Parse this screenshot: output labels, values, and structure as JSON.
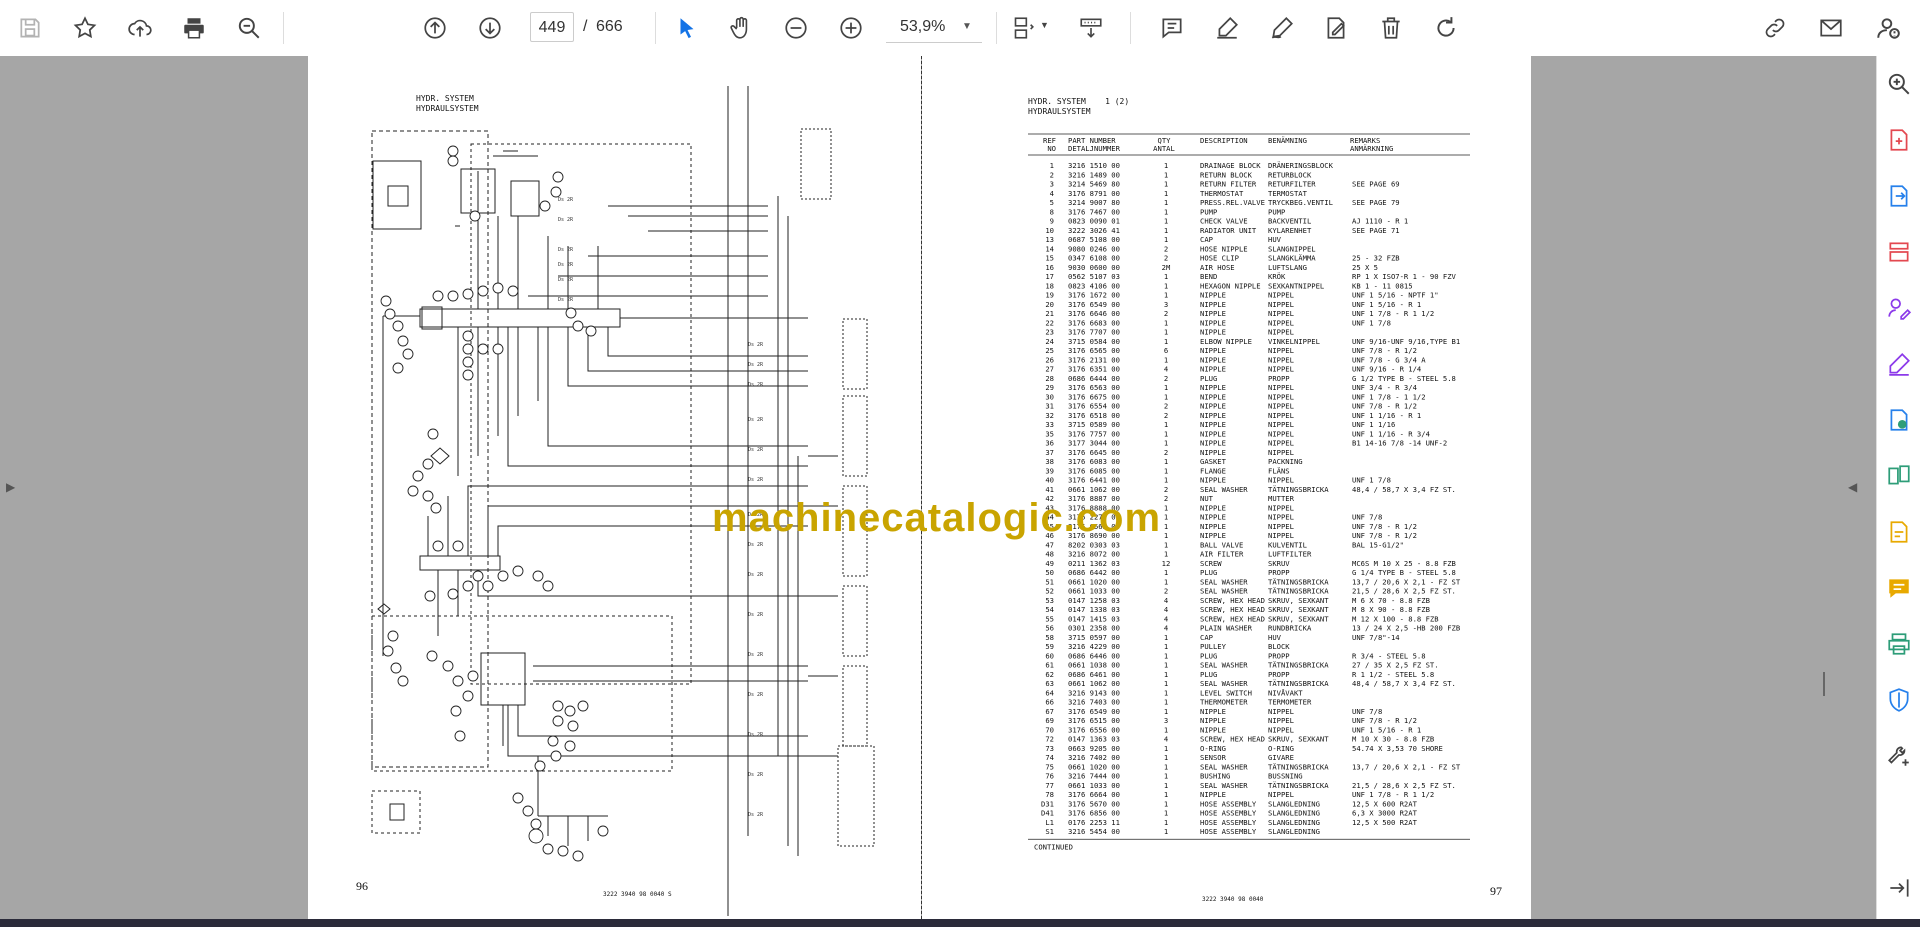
{
  "toolbar": {
    "current_page": "449",
    "page_separator": "/",
    "total_pages": "666",
    "zoom": "53,9%",
    "icons": [
      "save-icon",
      "bookmark-star-icon",
      "upload-icon",
      "print-icon",
      "zoom-search-icon",
      "page-up-icon",
      "page-down-icon",
      "select-cursor-icon",
      "hand-icon",
      "zoom-out-icon",
      "zoom-in-icon",
      "fit-page-icon",
      "scroll-mode-icon",
      "comment-icon",
      "highlight-icon",
      "draw-icon",
      "fill-sign-icon",
      "delete-icon",
      "redo-icon",
      "share-link-icon",
      "email-icon",
      "account-icon"
    ]
  },
  "colors": {
    "accent": "#1473e6",
    "viewer_bg": "#a6a6a6",
    "watermark": "#c9a400",
    "tool_red": "#e34850",
    "tool_blue": "#2680eb",
    "tool_purple": "#8c3aea",
    "tool_green": "#2d9d78",
    "tool_yellow": "#e8a900"
  },
  "left_page": {
    "title_1": "HYDR. SYSTEM",
    "title_2": "HYDRAULSYSTEM",
    "page_number": "96",
    "footer_code": "3222 3940 98   0040  S"
  },
  "right_page": {
    "title_1": "HYDR. SYSTEM    1 (2)",
    "title_2": "HYDRAULSYSTEM",
    "page_number": "97",
    "footer_code": "3222 3940 98   0040",
    "continued": "CONTINUED",
    "headers": [
      "REF NO",
      "PART NUMBER DETALJNUMMER",
      "QTY ANTAL",
      "DESCRIPTION",
      "BENÄMNING",
      "REMARKS ANMÄRKNING"
    ],
    "rows": [
      [
        "1",
        "3216 1510 00",
        "1",
        "DRAINAGE BLOCK",
        "DRÄNERINGSBLOCK",
        ""
      ],
      [
        "2",
        "3216 1489 00",
        "1",
        "RETURN BLOCK",
        "RETURBLOCK",
        ""
      ],
      [
        "3",
        "3214 5469 80",
        "1",
        "RETURN FILTER",
        "RETURFILTER",
        "SEE PAGE 69"
      ],
      [
        "4",
        "3176 8791 00",
        "1",
        "THERMOSTAT",
        "TERMOSTAT",
        ""
      ],
      [
        "5",
        "3214 9007 80",
        "1",
        "PRESS.REL.VALVE",
        "TRYCKBEG.VENTIL",
        "SEE PAGE 79"
      ],
      [
        "8",
        "3176 7467 00",
        "1",
        "PUMP",
        "PUMP",
        ""
      ],
      [
        "9",
        "0823 0090 01",
        "1",
        "CHECK VALVE",
        "BACKVENTIL",
        "AJ 1110 - R 1"
      ],
      [
        "10",
        "3222 3026 41",
        "1",
        "RADIATOR UNIT",
        "KYLARENHET",
        "SEE PAGE 71"
      ],
      [
        "13",
        "0687 5108 00",
        "1",
        "CAP",
        "HUV",
        ""
      ],
      [
        "14",
        "9080 0246 00",
        "2",
        "HOSE NIPPLE",
        "SLANGNIPPEL",
        ""
      ],
      [
        "15",
        "0347 6108 00",
        "2",
        "HOSE CLIP",
        "SLANGKLÄMMA",
        "25 - 32 FZB"
      ],
      [
        "16",
        "9030 0600 00",
        "2M",
        "AIR HOSE",
        "LUFTSLANG",
        "25   X 5"
      ],
      [
        "17",
        "0562 5107 03",
        "1",
        "BEND",
        "KRÖK",
        "RP 1 X ISO7-R 1 - 90 FZV"
      ],
      [
        "18",
        "0823 4106 00",
        "1",
        "HEXAGON NIPPLE",
        "SEXKANTNIPPEL",
        "KB 1 - 11 0815"
      ],
      [
        "19",
        "3176 1672 00",
        "1",
        "NIPPLE",
        "NIPPEL",
        "UNF 1 5/16 - NPTF 1\""
      ],
      [
        "20",
        "3176 6549 00",
        "3",
        "NIPPLE",
        "NIPPEL",
        "UNF 1 5/16 - R 1"
      ],
      [
        "21",
        "3176 6646 00",
        "2",
        "NIPPLE",
        "NIPPEL",
        "UNF 1 7/8 - R 1 1/2"
      ],
      [
        "22",
        "3176 6683 00",
        "1",
        "NIPPLE",
        "NIPPEL",
        "UNF 1 7/8"
      ],
      [
        "23",
        "3176 7707 00",
        "1",
        "NIPPLE",
        "NIPPEL",
        ""
      ],
      [
        "24",
        "3715 0584 00",
        "1",
        "ELBOW NIPPLE",
        "VINKELNIPPEL",
        "UNF 9/16-UNF 9/16,TYPE B1"
      ],
      [
        "25",
        "3176 6565 00",
        "6",
        "NIPPLE",
        "NIPPEL",
        "UNF 7/8 - R 1/2"
      ],
      [
        "26",
        "3176 2131 00",
        "1",
        "NIPPLE",
        "NIPPEL",
        "UNF 7/8 - G 3/4 A"
      ],
      [
        "27",
        "3176 6351 00",
        "4",
        "NIPPLE",
        "NIPPEL",
        "UNF 9/16 - R 1/4"
      ],
      [
        "28",
        "0686 6444 00",
        "2",
        "PLUG",
        "PROPP",
        "G 1/2 TYPE B - STEEL 5.8"
      ],
      [
        "29",
        "3176 6563 00",
        "1",
        "NIPPLE",
        "NIPPEL",
        "UNF 3/4 - R 3/4"
      ],
      [
        "30",
        "3176 6675 00",
        "1",
        "NIPPLE",
        "NIPPEL",
        "UNF 1 7/8 - 1 1/2"
      ],
      [
        "31",
        "3176 6554 00",
        "2",
        "NIPPLE",
        "NIPPEL",
        "UNF 7/8 - R 1/2"
      ],
      [
        "32",
        "3176 6518 00",
        "2",
        "NIPPLE",
        "NIPPEL",
        "UNF 1 1/16 - R 1"
      ],
      [
        "33",
        "3715 0589 00",
        "1",
        "NIPPLE",
        "NIPPEL",
        "UNF 1 1/16"
      ],
      [
        "35",
        "3176 7757 00",
        "1",
        "NIPPLE",
        "NIPPEL",
        "UNF 1 1/16 - R 3/4"
      ],
      [
        "36",
        "3177 3044 00",
        "1",
        "NIPPLE",
        "NIPPEL",
        "B1  14-16   7/8 -14 UNF-2"
      ],
      [
        "37",
        "3176 6645 00",
        "2",
        "NIPPLE",
        "NIPPEL",
        ""
      ],
      [
        "38",
        "3176 6083 00",
        "1",
        "GASKET",
        "PACKNING",
        ""
      ],
      [
        "39",
        "3176 6085 00",
        "1",
        "FLANGE",
        "FLÄNS",
        ""
      ],
      [
        "40",
        "3176 6441 00",
        "1",
        "NIPPLE",
        "NIPPEL",
        "UNF 1 7/8"
      ],
      [
        "41",
        "0661 1062 00",
        "2",
        "SEAL WASHER",
        "TÄTNINGSBRICKA",
        "48,4 / 58,7 X 3,4 FZ ST."
      ],
      [
        "42",
        "3176 8887 00",
        "2",
        "NUT",
        "MUTTER",
        ""
      ],
      [
        "43",
        "3176 8888 00",
        "1",
        "NIPPLE",
        "NIPPEL",
        ""
      ],
      [
        "44",
        "3176 2279 00",
        "1",
        "NIPPLE",
        "NIPPEL",
        "UNF 7/8"
      ],
      [
        "45",
        "3176 6565 00",
        "1",
        "NIPPLE",
        "NIPPEL",
        "UNF 7/8 - R 1/2"
      ],
      [
        "46",
        "3176 8690 00",
        "1",
        "NIPPLE",
        "NIPPEL",
        "UNF 7/8 - R 1/2"
      ],
      [
        "47",
        "8202 0303 03",
        "1",
        "BALL VALVE",
        "KULVENTIL",
        "BAL 15-G1/2\""
      ],
      [
        "48",
        "3216 8072 00",
        "1",
        "AIR FILTER",
        "LUFTFILTER",
        ""
      ],
      [
        "49",
        "0211 1362 03",
        "12",
        "SCREW",
        "SKRUV",
        "MC6S M 10 X 25 - 8.8 FZB"
      ],
      [
        "50",
        "0686 6442 00",
        "1",
        "PLUG",
        "PROPP",
        "G 1/4 TYPE B - STEEL 5.8"
      ],
      [
        "51",
        "0661 1020 00",
        "1",
        "SEAL WASHER",
        "TÄTNINGSBRICKA",
        "13,7 / 20,6 X 2,1 - FZ ST"
      ],
      [
        "52",
        "0661 1033 00",
        "2",
        "SEAL WASHER",
        "TÄTNINGSBRICKA",
        "21,5 / 28,6 X 2,5 FZ ST."
      ],
      [
        "53",
        "0147 1258 03",
        "4",
        "SCREW, HEX HEAD",
        "SKRUV, SEXKANT",
        "M 6 X 70 - 8.8 FZB"
      ],
      [
        "54",
        "0147 1338 03",
        "4",
        "SCREW, HEX HEAD",
        "SKRUV, SEXKANT",
        "M 8 X 90 - 8.8 FZB"
      ],
      [
        "55",
        "0147 1415 03",
        "4",
        "SCREW, HEX HEAD",
        "SKRUV, SEXKANT",
        "M 12 X 100 - 8.8 FZB"
      ],
      [
        "56",
        "0301 2358 00",
        "4",
        "PLAIN WASHER",
        "RUNDBRICKA",
        "13 / 24 X 2,5 -HB 200 FZB"
      ],
      [
        "58",
        "3715 0597 00",
        "1",
        "CAP",
        "HUV",
        "UNF 7/8\"-14"
      ],
      [
        "59",
        "3216 4229 00",
        "1",
        "PULLEY",
        "BLOCK",
        ""
      ],
      [
        "60",
        "0686 6446 00",
        "1",
        "PLUG",
        "PROPP",
        "R 3/4 - STEEL 5.8"
      ],
      [
        "61",
        "0661 1038 00",
        "1",
        "SEAL WASHER",
        "TÄTNINGSBRICKA",
        "27 / 35 X 2,5 FZ ST."
      ],
      [
        "62",
        "0686 6461 00",
        "1",
        "PLUG",
        "PROPP",
        "R 1 1/2 - STEEL 5.8"
      ],
      [
        "63",
        "0661 1062 00",
        "1",
        "SEAL WASHER",
        "TÄTNINGSBRICKA",
        "48,4 / 58,7 X 3,4 FZ ST."
      ],
      [
        "64",
        "3216 9143 00",
        "1",
        "LEVEL SWITCH",
        "NIVÅVAKT",
        ""
      ],
      [
        "66",
        "3216 7403 00",
        "1",
        "THERMOMETER",
        "TERMOMETER",
        ""
      ],
      [
        "67",
        "3176 6549 00",
        "1",
        "NIPPLE",
        "NIPPEL",
        "UNF 7/8"
      ],
      [
        "69",
        "3176 6515 00",
        "3",
        "NIPPLE",
        "NIPPEL",
        "UNF 7/8 - R 1/2"
      ],
      [
        "70",
        "3176 6556 00",
        "1",
        "NIPPLE",
        "NIPPEL",
        "UNF 1 5/16 - R 1"
      ],
      [
        "72",
        "0147 1363 03",
        "4",
        "SCREW, HEX HEAD",
        "SKRUV, SEXKANT",
        "M 10 X 30 - 8.8 FZB"
      ],
      [
        "73",
        "0663 9205 00",
        "1",
        "O-RING",
        "O-RING",
        "54.74 X 3,53 70 SHORE"
      ],
      [
        "74",
        "3216 7402 00",
        "1",
        "SENSOR",
        "GIVARE",
        ""
      ],
      [
        "75",
        "0661 1020 00",
        "1",
        "SEAL WASHER",
        "TÄTNINGSBRICKA",
        "13,7 / 20,6 X 2,1 - FZ ST"
      ],
      [
        "76",
        "3216 7444 00",
        "1",
        "BUSHING",
        "BUSSNING",
        ""
      ],
      [
        "77",
        "0661 1033 00",
        "1",
        "SEAL WASHER",
        "TÄTNINGSBRICKA",
        "21,5 / 28,6 X 2,5 FZ ST."
      ],
      [
        "78",
        "3176 6664 00",
        "1",
        "NIPPLE",
        "NIPPEL",
        "UNF 1 7/8 - R 1 1/2"
      ],
      [
        "D31",
        "3176 5670 00",
        "1",
        "HOSE ASSEMBLY",
        "SLANGLEDNING",
        "12,5 X 600 R2AT"
      ],
      [
        "D41",
        "3176 6856 00",
        "1",
        "HOSE ASSEMBLY",
        "SLANGLEDNING",
        "6,3 X 3000 R2AT"
      ],
      [
        "L1",
        "0176 2253 11",
        "1",
        "HOSE ASSEMBLY",
        "SLANGLEDNING",
        "12,5 X 500 R2AT"
      ],
      [
        "S1",
        "3216 5454 00",
        "1",
        "HOSE ASSEMBLY",
        "SLANGLEDNING",
        ""
      ]
    ]
  },
  "watermark": "machinecatalogic.com"
}
